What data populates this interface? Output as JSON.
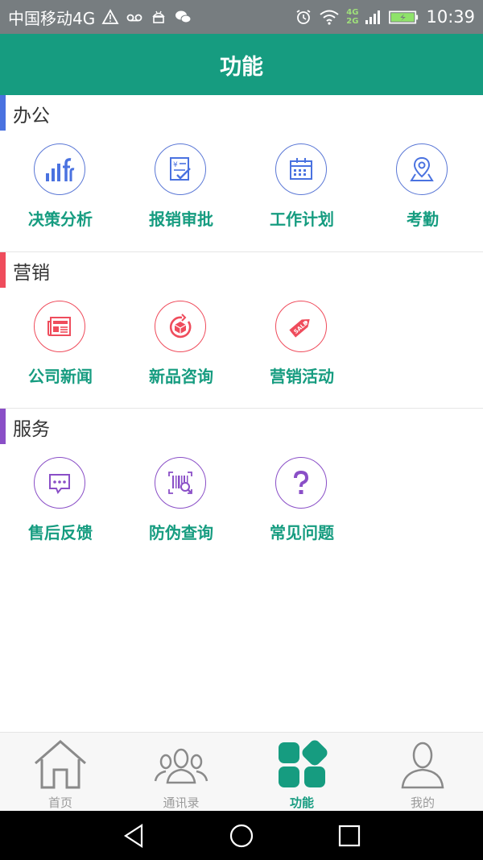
{
  "status_bar": {
    "carrier": "中国移动4G",
    "network_badge_top": "4G",
    "network_badge_bottom": "2G",
    "time": "10:39"
  },
  "header": {
    "title": "功能"
  },
  "sections": [
    {
      "title": "办公",
      "accent": "#4a72e0",
      "items": [
        {
          "label": "决策分析",
          "icon": "bar-chart-icon"
        },
        {
          "label": "报销审批",
          "icon": "expense-approval-icon"
        },
        {
          "label": "工作计划",
          "icon": "calendar-icon"
        },
        {
          "label": "考勤",
          "icon": "map-pin-icon"
        }
      ]
    },
    {
      "title": "营销",
      "accent": "#ef4c5c",
      "items": [
        {
          "label": "公司新闻",
          "icon": "newspaper-icon"
        },
        {
          "label": "新品咨询",
          "icon": "new-product-icon"
        },
        {
          "label": "营销活动",
          "icon": "sale-tag-icon"
        }
      ]
    },
    {
      "title": "服务",
      "accent": "#8a4fc7",
      "items": [
        {
          "label": "售后反馈",
          "icon": "chat-bubble-icon"
        },
        {
          "label": "防伪查询",
          "icon": "barcode-search-icon"
        },
        {
          "label": "常见问题",
          "icon": "question-icon"
        }
      ]
    }
  ],
  "bottom_nav": {
    "items": [
      {
        "label": "首页",
        "icon": "home-icon"
      },
      {
        "label": "通讯录",
        "icon": "contacts-icon"
      },
      {
        "label": "功能",
        "icon": "apps-grid-icon",
        "active": true
      },
      {
        "label": "我的",
        "icon": "profile-icon"
      }
    ]
  },
  "colors": {
    "primary": "#169c80",
    "status_bar": "#777d80",
    "office_blue": "#5b78d6",
    "marketing_red": "#ef4c5c",
    "service_purple": "#8a4fc7"
  }
}
